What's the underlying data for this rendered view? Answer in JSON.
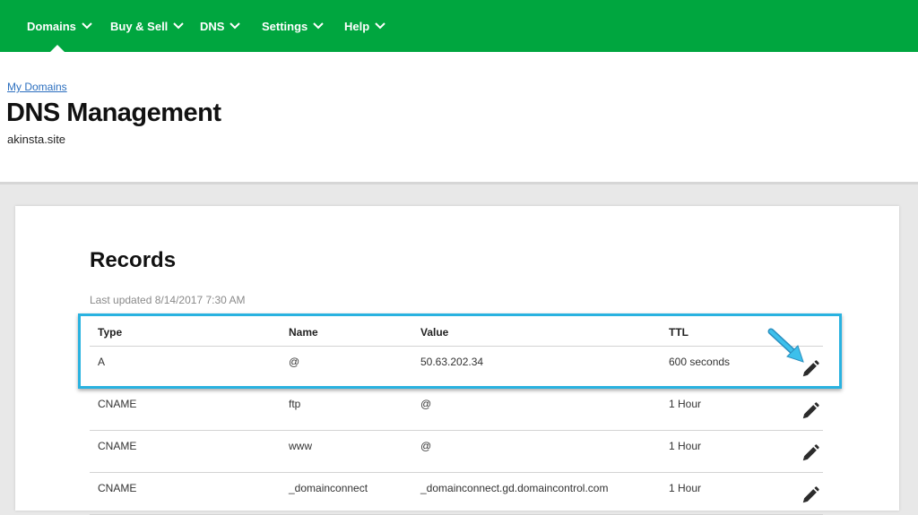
{
  "nav": {
    "items": [
      {
        "label": "Domains"
      },
      {
        "label": "Buy & Sell"
      },
      {
        "label": "DNS"
      },
      {
        "label": "Settings"
      },
      {
        "label": "Help"
      }
    ]
  },
  "breadcrumb": "My Domains",
  "page": {
    "title": "DNS Management",
    "domain": "akinsta.site"
  },
  "records": {
    "title": "Records",
    "last_updated": "Last updated 8/14/2017 7:30 AM",
    "columns": [
      "Type",
      "Name",
      "Value",
      "TTL"
    ],
    "rows": [
      {
        "type": "A",
        "name": "@",
        "value": "50.63.202.34",
        "ttl": "600 seconds"
      },
      {
        "type": "CNAME",
        "name": "ftp",
        "value": "@",
        "ttl": "1 Hour"
      },
      {
        "type": "CNAME",
        "name": "www",
        "value": "@",
        "ttl": "1 Hour"
      },
      {
        "type": "CNAME",
        "name": "_domainconnect",
        "value": "_domainconnect.gd.domaincontrol.com",
        "ttl": "1 Hour"
      }
    ]
  },
  "colors": {
    "nav_bg": "#00a63f",
    "highlight": "#29b2e0",
    "link": "#2c6fbf"
  },
  "icons": [
    "chevron-down-icon",
    "pencil-icon",
    "arrow-annotation"
  ]
}
